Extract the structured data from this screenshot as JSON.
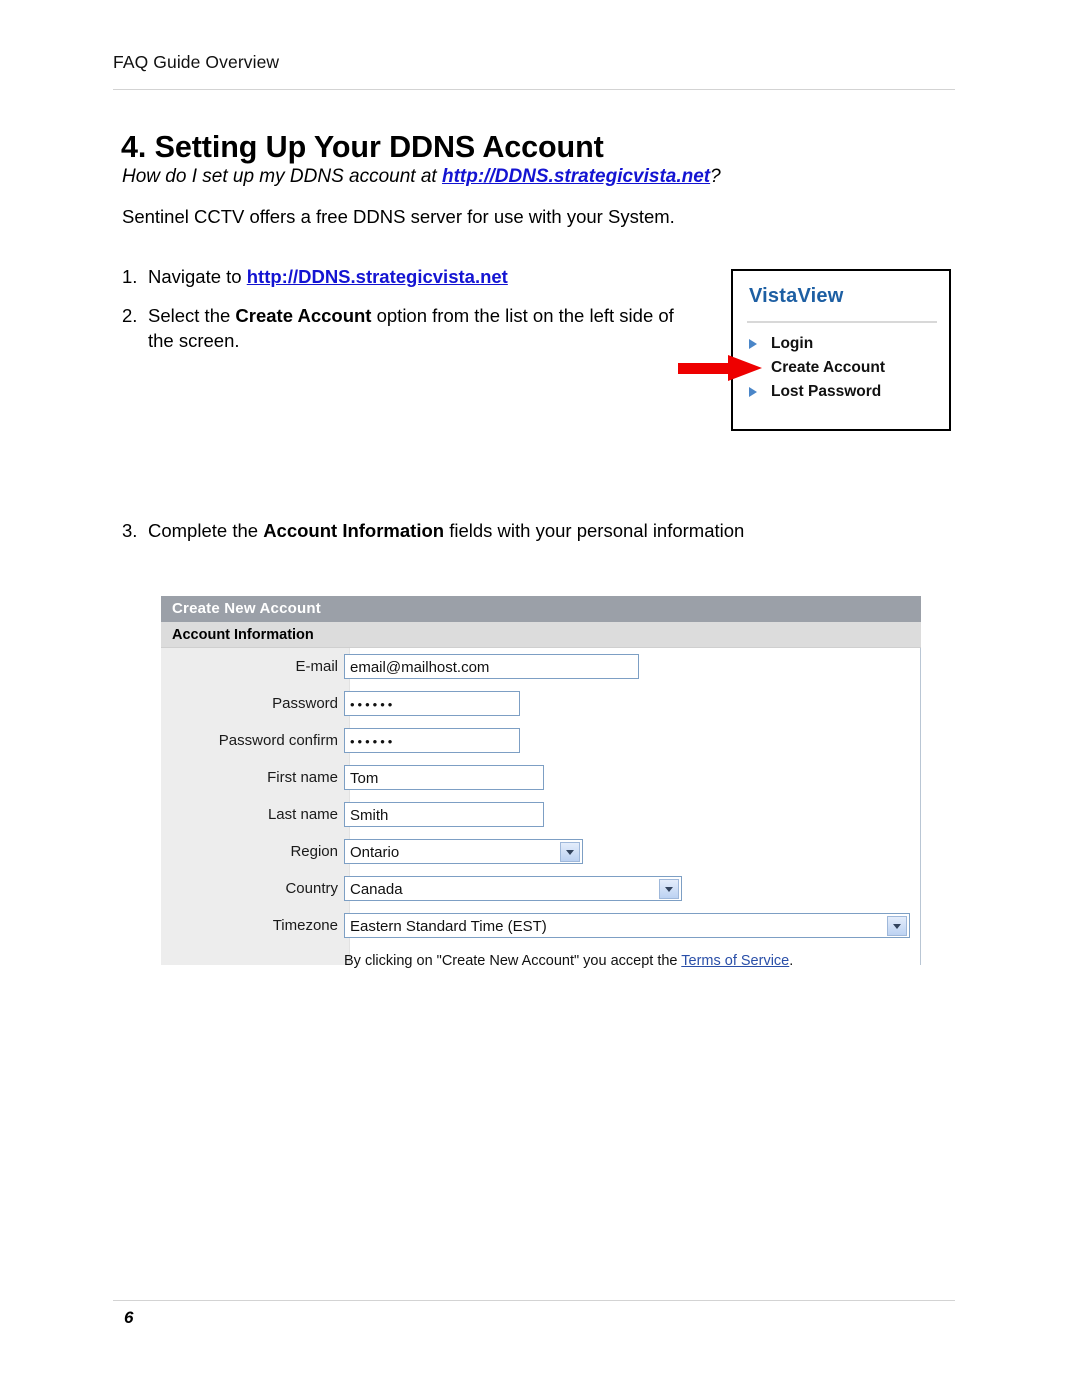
{
  "header": {
    "running_head": "FAQ Guide Overview"
  },
  "title": "4. Setting Up Your DDNS Account",
  "question": {
    "prefix": "How do I set up my DDNS account at ",
    "link": "http://DDNS.strategicvista.net",
    "suffix": "?"
  },
  "intro": "Sentinel CCTV offers a free DDNS server for use with your System.",
  "steps": [
    {
      "num": "1.",
      "prefix": "Navigate to ",
      "link": "http://DDNS.strategicvista.net",
      "suffix": ""
    },
    {
      "num": "2.",
      "prefix": "Select the ",
      "bold": "Create Account",
      "suffix": " option from the list on the left side of the screen."
    },
    {
      "num": "3.",
      "prefix": "Complete the ",
      "bold": "Account Information",
      "suffix": " fields with your personal information"
    }
  ],
  "vistaview": {
    "title": "VistaView",
    "items": [
      {
        "label": "Login",
        "highlighted": false
      },
      {
        "label": "Create Account",
        "highlighted": true
      },
      {
        "label": "Lost Password",
        "highlighted": false
      }
    ],
    "title_color": "#1d5fa3",
    "bullet_color": "#4a86c8",
    "arrow_color": "#ee0000"
  },
  "form": {
    "titlebar": "Create New Account",
    "section": "Account Information",
    "fields": [
      {
        "label": "E-mail",
        "value": "email@mailhost.com",
        "type": "text",
        "width": "w-email"
      },
      {
        "label": "Password",
        "value": "••••••",
        "type": "password",
        "width": "w-pass"
      },
      {
        "label": "Password confirm",
        "value": "••••••",
        "type": "password",
        "width": "w-pass"
      },
      {
        "label": "First name",
        "value": "Tom",
        "type": "text",
        "width": "w-name"
      },
      {
        "label": "Last name",
        "value": "Smith",
        "type": "text",
        "width": "w-name"
      },
      {
        "label": "Region",
        "value": "Ontario",
        "type": "select",
        "width": "w-region"
      },
      {
        "label": "Country",
        "value": "Canada",
        "type": "select",
        "width": "w-country"
      },
      {
        "label": "Timezone",
        "value": "Eastern Standard Time (EST)",
        "type": "select",
        "width": "w-tz"
      }
    ],
    "terms": {
      "prefix": "By clicking on \"Create New Account\" you accept the ",
      "link": "Terms of Service",
      "suffix": "."
    },
    "titlebar_bg": "#9ba0a8",
    "section_bg": "#dcdcdc",
    "label_col_bg": "#ededed",
    "field_border": "#7d9fc4"
  },
  "footer": {
    "page_number": "6"
  }
}
